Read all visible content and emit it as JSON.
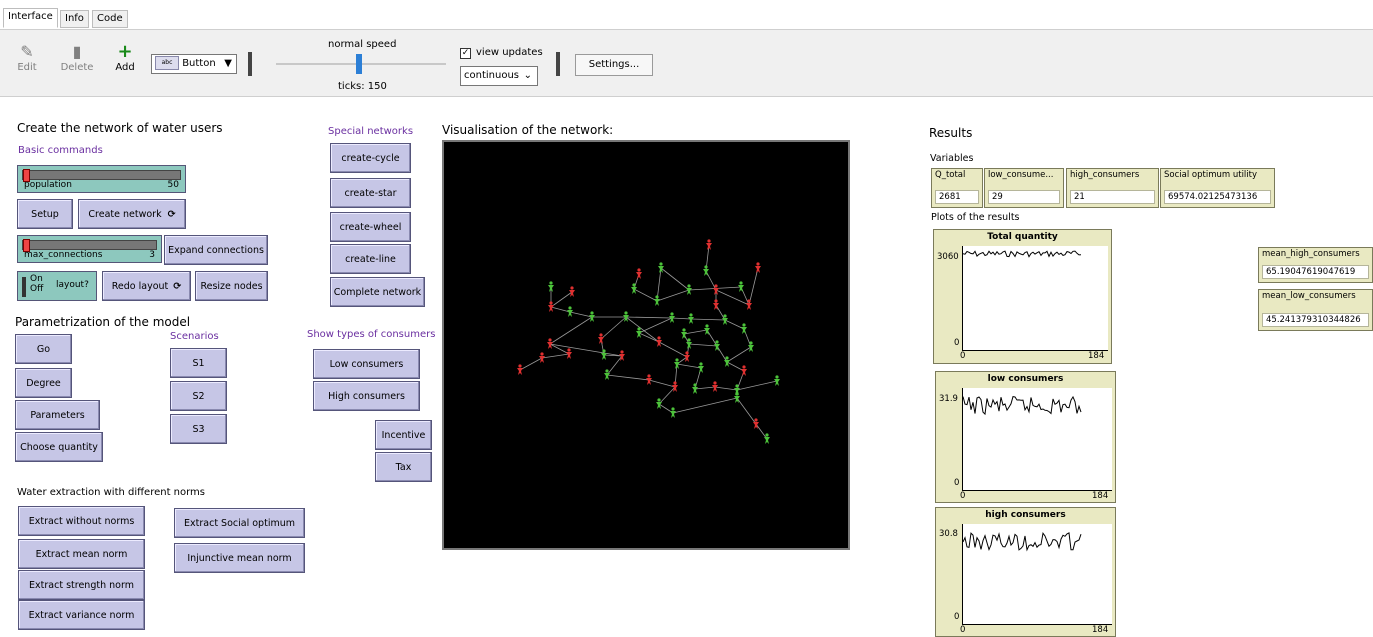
{
  "tabs": [
    "Interface",
    "Info",
    "Code"
  ],
  "toolbar": {
    "edit_label": "Edit",
    "delete_label": "Delete",
    "add_label": "Add",
    "widget_type": "Button",
    "speed_label": "normal speed",
    "ticks_label": "ticks: 150",
    "view_updates_label": "view updates",
    "view_updates_checked": true,
    "update_mode": "continuous",
    "settings_label": "Settings..."
  },
  "left": {
    "title": "Create the network of water users",
    "basic_commands": "Basic commands",
    "population": {
      "label": "population",
      "value": "50"
    },
    "setup": "Setup",
    "create_network": "Create network",
    "max_connections": {
      "label": "max_connections",
      "value": "3"
    },
    "expand_connections": "Expand connections",
    "layout_switch": {
      "on": "On",
      "off": "Off",
      "label": "layout?"
    },
    "redo_layout": "Redo layout",
    "resize_nodes": "Resize nodes",
    "param_title": "Parametrization of the model",
    "scenarios": "Scenarios",
    "go": "Go",
    "degree": "Degree",
    "parameters": "Parameters",
    "choose_quantity": "Choose quantity",
    "s1": "S1",
    "s2": "S2",
    "s3": "S3",
    "extraction_title": "Water extraction with different norms",
    "extract_without": "Extract without norms",
    "extract_mean": "Extract mean norm",
    "extract_strength": "Extract strength norm",
    "extract_variance": "Extract variance norm",
    "extract_social": "Extract Social optimum",
    "injunctive_mean": "Injunctive mean norm"
  },
  "special": {
    "title": "Special networks",
    "create_cycle": "create-cycle",
    "create_star": "create-star",
    "create_wheel": "create-wheel",
    "create_line": "create-line",
    "complete_network": "Complete network",
    "show_types": "Show types of consumers",
    "low_consumers": "Low consumers",
    "high_consumers": "High consumers",
    "incentive": "Incentive",
    "tax": "Tax"
  },
  "view": {
    "title": "Visualisation of the network:",
    "red_color": "#e03030",
    "green_color": "#4cc23a",
    "link_color": "#9a9a9a"
  },
  "results": {
    "title": "Results",
    "variables": "Variables",
    "plots_title": "Plots of the results",
    "q_total": {
      "label": "Q_total",
      "value": "2681"
    },
    "low_consumers": {
      "label": "low_consume...",
      "value": "29"
    },
    "high_consumers": {
      "label": "high_consumers",
      "value": "21"
    },
    "social_optimum": {
      "label": "Social optimum utility",
      "value": "69574.02125473136"
    },
    "mean_high": {
      "label": "mean_high_consumers",
      "value": "65.19047619047619"
    },
    "mean_low": {
      "label": "mean_low_consumers",
      "value": "45.241379310344826"
    }
  },
  "plots": [
    {
      "title": "Total quantity",
      "ymax": "3060",
      "ymin": "0",
      "xmin": "0",
      "xmax": "184"
    },
    {
      "title": "low consumers",
      "ymax": "31.9",
      "ymin": "0",
      "xmin": "0",
      "xmax": "184"
    },
    {
      "title": "high consumers",
      "ymax": "30.8",
      "ymin": "0",
      "xmin": "0",
      "xmax": "184"
    }
  ]
}
